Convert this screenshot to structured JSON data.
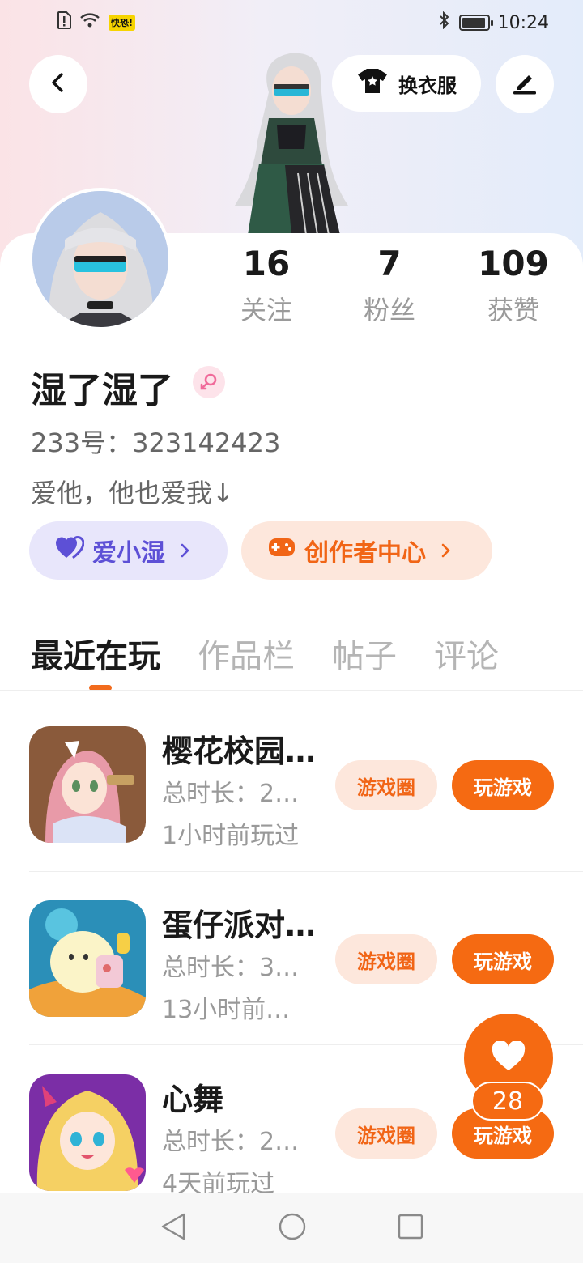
{
  "status_bar": {
    "left_badge": "快恐!",
    "time": "10:24"
  },
  "header": {
    "back_icon": "back-arrow-icon",
    "dress_button_label": "换衣服",
    "dress_icon": "tshirt-icon",
    "edit_icon": "edit-pen-icon"
  },
  "profile": {
    "stats": [
      {
        "value": "16",
        "label": "关注"
      },
      {
        "value": "7",
        "label": "粉丝"
      },
      {
        "value": "109",
        "label": "获赞"
      }
    ],
    "username": "湿了湿了",
    "gender_icon": "female-icon",
    "id_line": "233号：323142423",
    "bio": "爱他，他也爱我↓",
    "chips": [
      {
        "label": "爱小湿",
        "icon": "heart-icon",
        "color": "#5d50d6"
      },
      {
        "label": "创作者中心",
        "icon": "gamepad-icon",
        "color": "#f16516"
      }
    ]
  },
  "tabs": [
    {
      "label": "最近在玩",
      "active": true
    },
    {
      "label": "作品栏",
      "active": false
    },
    {
      "label": "帖子",
      "active": false
    },
    {
      "label": "评论",
      "active": false
    }
  ],
  "games": [
    {
      "title": "樱花校园…",
      "duration": "总时长：2…",
      "last_played": "1小时前玩过",
      "circle_label": "游戏圈",
      "play_label": "玩游戏"
    },
    {
      "title": "蛋仔派对…",
      "duration": "总时长：3…",
      "last_played": "13小时前…",
      "circle_label": "游戏圈",
      "play_label": "玩游戏"
    },
    {
      "title": "心舞",
      "duration": "总时长：2…",
      "last_played": "4天前玩过",
      "circle_label": "游戏圈",
      "play_label": "玩游戏"
    }
  ],
  "fab": {
    "count": "28",
    "icon": "heart-icon"
  },
  "accent_color": "#f56a12"
}
